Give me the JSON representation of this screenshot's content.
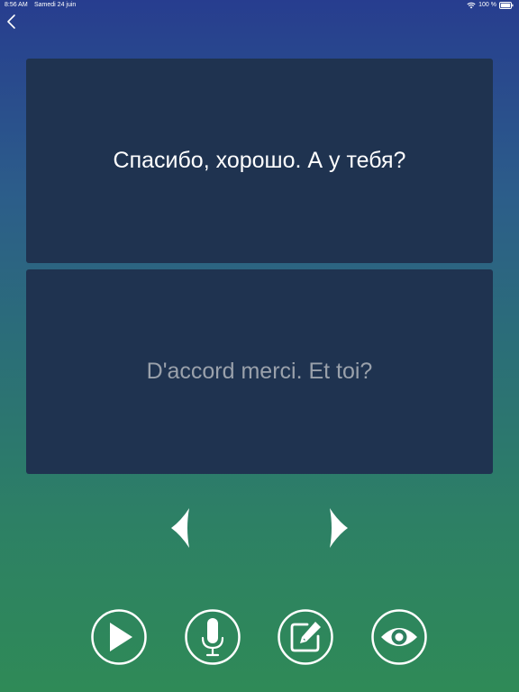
{
  "status_bar": {
    "time": "8:56 AM",
    "date": "Samedi 24 juin",
    "battery": "100 %"
  },
  "card": {
    "phrase": "Спасибо, хорошо. А у тебя?",
    "translation": "D'accord merci. Et toi?"
  },
  "icons": {
    "back": "chevron-left-icon",
    "previous": "triangle-left-icon",
    "next": "triangle-right-icon",
    "play": "play-icon",
    "record": "microphone-icon",
    "edit": "edit-icon",
    "reveal": "eye-icon"
  },
  "colors": {
    "card_background": "#1f3350",
    "primary_text": "#ffffff",
    "secondary_text": "#9aa1ab",
    "gradient_top": "#273d8f",
    "gradient_bottom": "#2f8a57"
  }
}
